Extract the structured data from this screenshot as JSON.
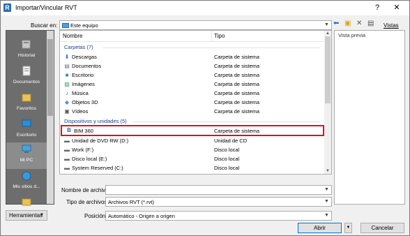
{
  "window": {
    "title": "Importar/Vincular RVT",
    "app_icon_letter": "R",
    "help_glyph": "?",
    "close_glyph": "✕"
  },
  "lookin": {
    "label": "Buscar en:",
    "value": "Este equipo"
  },
  "views_label": "Vistas",
  "places": [
    {
      "label": "Historial"
    },
    {
      "label": "Documentos"
    },
    {
      "label": "Favoritos"
    },
    {
      "label": "Escritorio"
    },
    {
      "label": "Mi PC"
    },
    {
      "label": "Mis sitios d..."
    }
  ],
  "filelist": {
    "headers": {
      "name": "Nombre",
      "type": "Tipo"
    },
    "group_folders": "Carpetas (7)",
    "group_devices": "Dispositivos y unidades (5)",
    "folders": [
      {
        "name": "Descargas",
        "type": "Carpeta de sistema",
        "icon": "download-icon"
      },
      {
        "name": "Documentos",
        "type": "Carpeta de sistema",
        "icon": "document-icon"
      },
      {
        "name": "Escritorio",
        "type": "Carpeta de sistema",
        "icon": "desktop-icon"
      },
      {
        "name": "Imágenes",
        "type": "Carpeta de sistema",
        "icon": "pictures-icon"
      },
      {
        "name": "Música",
        "type": "Carpeta de sistema",
        "icon": "music-icon"
      },
      {
        "name": "Objetos 3D",
        "type": "Carpeta de sistema",
        "icon": "cube-icon"
      },
      {
        "name": "Vídeos",
        "type": "Carpeta de sistema",
        "icon": "video-icon"
      }
    ],
    "devices": [
      {
        "name": "BIM 360",
        "type": "Carpeta de sistema",
        "icon": "bim360-icon"
      },
      {
        "name": "Unidad de DVD RW (D:)",
        "type": "Unidad de CD",
        "icon": "dvd-drive-icon"
      },
      {
        "name": "Work (F:)",
        "type": "Disco local",
        "icon": "disk-icon"
      },
      {
        "name": "Disco local (E:)",
        "type": "Disco local",
        "icon": "disk-icon"
      },
      {
        "name": "System Reserved (C:)",
        "type": "Disco local",
        "icon": "disk-icon"
      }
    ]
  },
  "preview_label": "Vista previa",
  "filename": {
    "label": "Nombre de archivo:",
    "value": ""
  },
  "filetype": {
    "label": "Tipo de archivos:",
    "value": "Archivos RVT  (*.rvt)"
  },
  "position": {
    "label": "Posición:",
    "value": "Automático - Origen a origen"
  },
  "buttons": {
    "tools": "Herramientas",
    "open": "Abrir",
    "cancel": "Cancelar"
  },
  "colors": {
    "highlight_border": "#e0101a",
    "group_text": "#1e3c8c",
    "places_bg": "#6d6d6d"
  }
}
